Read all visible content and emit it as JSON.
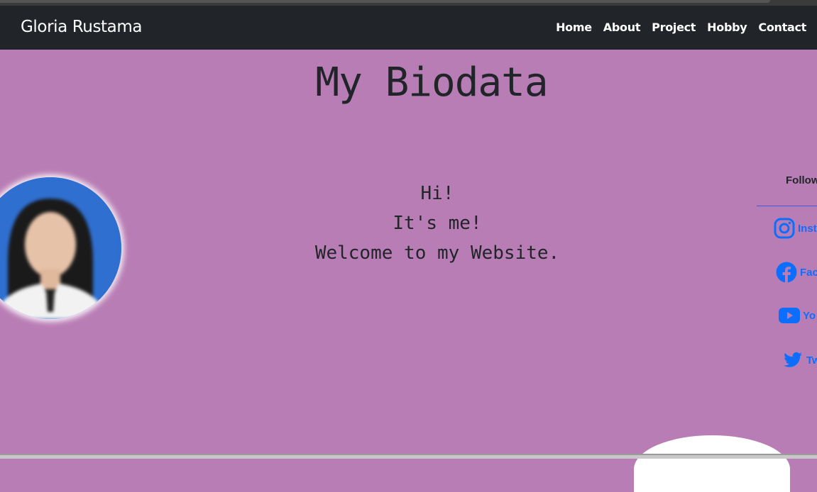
{
  "navbar": {
    "brand": "Gloria Rustama",
    "links": [
      "Home",
      "About",
      "Project",
      "Hobby",
      "Contact"
    ]
  },
  "main": {
    "title": "My Biodata",
    "greeting": [
      "Hi!",
      "It's me!",
      "Welcome to my Website."
    ]
  },
  "sidebar": {
    "heading": "Follow",
    "socials": [
      {
        "label": "Inst",
        "icon": "instagram-icon"
      },
      {
        "label": "Fac",
        "icon": "facebook-icon"
      },
      {
        "label": "Yo",
        "icon": "youtube-icon"
      },
      {
        "label": "Tw",
        "icon": "twitter-icon"
      }
    ]
  },
  "colors": {
    "background": "#b97db5",
    "navbar": "#212529",
    "link": "#0d6efd"
  }
}
